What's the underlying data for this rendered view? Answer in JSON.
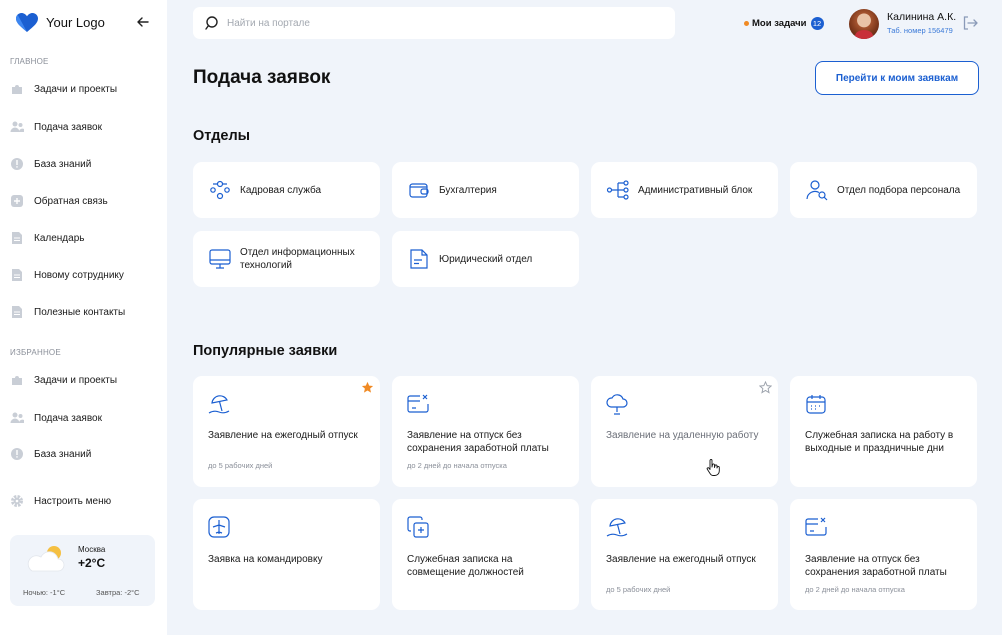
{
  "app": {
    "logo_text": "Your Logo"
  },
  "sidebar": {
    "main_label": "ГЛАВНОЕ",
    "main_items": [
      {
        "label": "Задачи и проекты",
        "icon": "puzzle-icon"
      },
      {
        "label": "Подача заявок",
        "icon": "users-icon"
      },
      {
        "label": "База знаний",
        "icon": "info-icon"
      },
      {
        "label": "Обратная связь",
        "icon": "plus-icon"
      },
      {
        "label": "Календарь",
        "icon": "document-icon"
      },
      {
        "label": "Новому сотруднику",
        "icon": "document-icon"
      },
      {
        "label": "Полезные контакты",
        "icon": "document-icon"
      }
    ],
    "favorites_label": "ИЗБРАННОЕ",
    "favorite_items": [
      {
        "label": "Задачи и проекты",
        "icon": "puzzle-icon"
      },
      {
        "label": "Подача заявок",
        "icon": "users-icon"
      },
      {
        "label": "База знаний",
        "icon": "info-icon"
      }
    ],
    "settings_label": "Настроить меню"
  },
  "weather": {
    "city": "Москва",
    "temp": "+2°C",
    "night": "Ночью: -1°C",
    "tomorrow": "Завтра: -2°C"
  },
  "header": {
    "search_placeholder": "Найти на портале",
    "tasks_label": "Мои задачи",
    "tasks_count": "12",
    "user_name": "Калинина А.К.",
    "user_tab": "Таб. номер 156479"
  },
  "page": {
    "title": "Подача заявок",
    "goto_button": "Перейти к моим заявкам",
    "departments_title": "Отделы",
    "popular_title": "Популярные заявки"
  },
  "departments": [
    {
      "label": "Кадровая служба",
      "icon": "people-group-icon"
    },
    {
      "label": "Бухгалтерия",
      "icon": "wallet-icon"
    },
    {
      "label": "Административный блок",
      "icon": "hierarchy-icon"
    },
    {
      "label": "Отдел подбора персонала",
      "icon": "user-search-icon"
    },
    {
      "label": "Отдел информационных технологий",
      "icon": "monitor-icon"
    },
    {
      "label": "Юридический отдел",
      "icon": "legal-document-icon"
    }
  ],
  "requests": [
    {
      "title": "Заявление на ежегодный отпуск",
      "subtitle": "до 5 рабочих дней",
      "icon": "beach-umbrella-icon",
      "star": "filled"
    },
    {
      "title": "Заявление на отпуск без сохранения заработной платы",
      "subtitle": "до 2 дней до начала отпуска",
      "icon": "card-cancel-icon",
      "star": "none"
    },
    {
      "title": "Заявление на удаленную работу",
      "subtitle": "",
      "icon": "cloud-icon",
      "star": "outline"
    },
    {
      "title": "Служебная записка на работу в выходные и праздничные дни",
      "subtitle": "",
      "icon": "calendar-icon",
      "star": "none"
    },
    {
      "title": "Заявка на командировку",
      "subtitle": "",
      "icon": "airplane-icon",
      "star": "none"
    },
    {
      "title": "Служебная записка на совмещение должностей",
      "subtitle": "",
      "icon": "copy-plus-icon",
      "star": "none"
    },
    {
      "title": "Заявление на ежегодный отпуск",
      "subtitle": "до 5 рабочих дней",
      "icon": "beach-umbrella-icon",
      "star": "none"
    },
    {
      "title": "Заявление на отпуск без сохранения заработной платы",
      "subtitle": "до 2 дней до начала отпуска",
      "icon": "card-cancel-icon",
      "star": "none"
    }
  ],
  "colors": {
    "accent": "#1b5fd1",
    "background": "#f0f4fa",
    "star": "#f08a24"
  }
}
